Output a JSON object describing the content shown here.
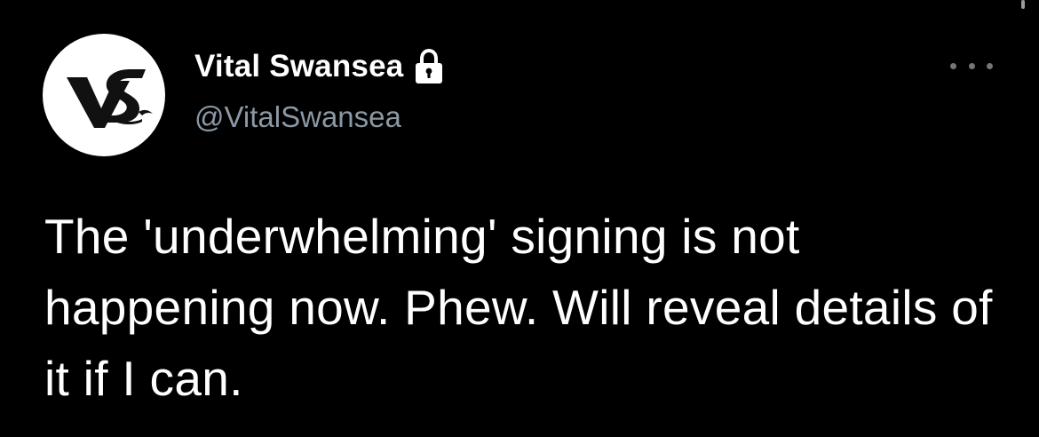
{
  "tweet": {
    "author": {
      "display_name": "Vital Swansea",
      "handle": "@VitalSwansea",
      "avatar_icon": "vs-logo",
      "protected_icon": "lock-icon"
    },
    "more_icon": "more-options-icon",
    "text": "The 'underwhelming' signing is not happening now. Phew. Will reveal details of it if I can."
  },
  "colors": {
    "background": "#000000",
    "display_name": "#ffffff",
    "handle": "#8b98a5",
    "body_text": "#ffffff"
  }
}
